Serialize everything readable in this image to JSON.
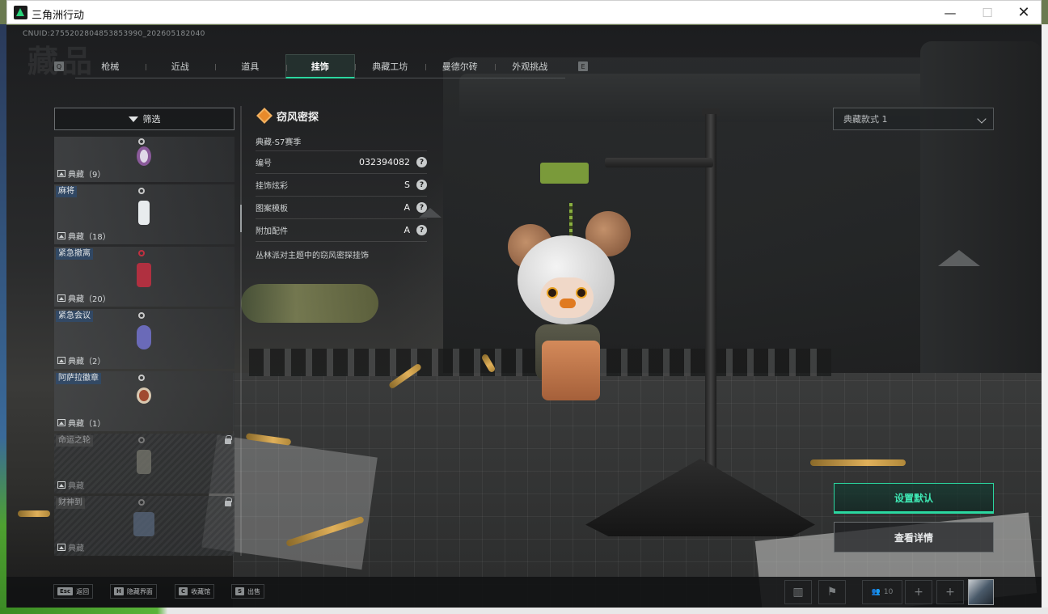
{
  "window": {
    "title": "三角洲行动",
    "minimize": "—",
    "maximize": "☐",
    "close": "✕"
  },
  "header": {
    "cnuid": "CNUID:2755202804853853990_202605182040",
    "ghost_title": "藏品",
    "key_prev": "Q",
    "key_next": "E",
    "tabs": [
      {
        "label": "枪械"
      },
      {
        "label": "近战"
      },
      {
        "label": "道具"
      },
      {
        "label": "挂饰",
        "active": true
      },
      {
        "label": "典藏工坊"
      },
      {
        "label": "曼德尔砖"
      },
      {
        "label": "外观挑战"
      }
    ]
  },
  "filter": {
    "label": "筛选",
    "icon": "filter-icon"
  },
  "list": {
    "items": [
      {
        "tag": "",
        "count": "典藏（9）",
        "locked": false,
        "color": "#8a5a9a"
      },
      {
        "tag": "麻将",
        "count": "典藏（18）",
        "locked": false,
        "color": "#e8ecee"
      },
      {
        "tag": "紧急撤离",
        "count": "典藏（20）",
        "locked": false,
        "color": "#b03040"
      },
      {
        "tag": "紧急会议",
        "count": "典藏（2）",
        "locked": false,
        "color": "#6a6ab8"
      },
      {
        "tag": "阿萨拉徽章",
        "count": "典藏（1）",
        "locked": false,
        "color": "#a04a30"
      },
      {
        "tag": "命运之轮",
        "count": "典藏",
        "locked": true,
        "color": "#7a7a70"
      },
      {
        "tag": "财神到",
        "count": "典藏",
        "locked": true,
        "color": "#5a6a80"
      }
    ]
  },
  "info": {
    "name": "窃风密探",
    "season": "典藏-S7赛季",
    "rows": [
      {
        "label": "编号",
        "value": "032394082"
      },
      {
        "label": "挂饰炫彩",
        "value": "S"
      },
      {
        "label": "图案模板",
        "value": "A"
      },
      {
        "label": "附加配件",
        "value": "A"
      }
    ],
    "qmark": "?",
    "description": "丛林派对主题中的窃风密探挂饰"
  },
  "right": {
    "style_select": "典藏款式 1",
    "set_default": "设置默认",
    "view_detail": "查看详情"
  },
  "bottom": {
    "hints": [
      {
        "key": "Esc",
        "label": "返回"
      },
      {
        "key": "H",
        "label": "隐藏界面"
      },
      {
        "key": "C",
        "label": "收藏馆"
      },
      {
        "key": "S",
        "label": "出售"
      }
    ],
    "friends_count": "10",
    "plus": "+"
  },
  "colors": {
    "accent": "#2bd7a0",
    "orange": "#e88a2a"
  }
}
